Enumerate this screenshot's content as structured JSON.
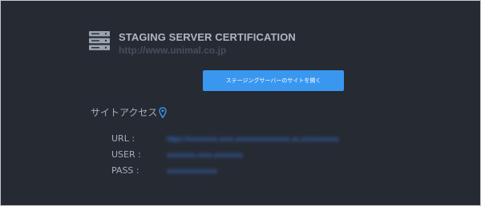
{
  "header": {
    "title": "STAGING SERVER CERTIFICATION",
    "url": "http://www.unimal.co.jp",
    "icon": "server-icon"
  },
  "action": {
    "open_site_label": "ステージングサーバーのサイトを開く"
  },
  "site_access": {
    "heading": "サイトアクセス",
    "icon": "location-pin-icon",
    "rows": [
      {
        "label": "URL :",
        "value": "https://xxxxxxxx.xxxx.xxxxxxxxxxxxxxx.xx.xx/xxxxxxxx"
      },
      {
        "label": "USER :",
        "value": "xxxxxxxx.xxxx.xxxxxxxx"
      },
      {
        "label": "PASS :",
        "value": "xxxxxxxxxxxxxx"
      }
    ]
  },
  "colors": {
    "background": "#262a33",
    "button": "#3a97f0",
    "title": "#aeb6c2",
    "accent_icon": "#3a97f0",
    "masked_value": "#3b7fe6"
  }
}
